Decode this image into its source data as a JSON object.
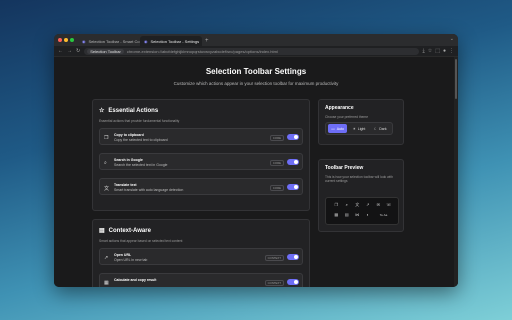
{
  "browser": {
    "tabs": [
      {
        "label": "Selection Toolbar - Smart Co"
      },
      {
        "label": "Selection Toolbar - Settings"
      }
    ],
    "url_chip": "Selection Toolbar",
    "url": "chrome-extension://abcfdefghijklmnopqrstuvwxyzabcdef/src/pages/options/index.html"
  },
  "page": {
    "title": "Selection Toolbar Settings",
    "subtitle": "Customize which actions appear in your selection toolbar for maximum productivity"
  },
  "essential": {
    "title": "Essential Actions",
    "desc": "Essential actions that provide fundamental functionality",
    "items": [
      {
        "title": "Copy to clipboard",
        "desc": "Copy the selected text to clipboard",
        "badge": "CORE",
        "icon": "copy-icon"
      },
      {
        "title": "Search in Google",
        "desc": "Search the selected text in Google",
        "badge": "CORE",
        "icon": "search-icon"
      },
      {
        "title": "Translate text",
        "desc": "Smart translate with auto language detection",
        "badge": "CORE",
        "icon": "translate-icon"
      }
    ]
  },
  "context": {
    "title": "Context-Aware",
    "desc": "Smart actions that appear based on selected text content",
    "items": [
      {
        "title": "Open URL",
        "desc": "Open URL in new tab",
        "badge": "CONTEXT",
        "icon": "external-link-icon"
      },
      {
        "title": "Calculate and copy result",
        "desc": "",
        "badge": "CONTEXT",
        "icon": "calculator-icon"
      }
    ]
  },
  "appearance": {
    "title": "Appearance",
    "desc": "Choose your preferred theme",
    "options": [
      {
        "label": "Auto",
        "selected": true
      },
      {
        "label": "Light",
        "selected": false
      },
      {
        "label": "Dark",
        "selected": false
      }
    ]
  },
  "preview": {
    "title": "Toolbar Preview",
    "desc": "This is how your selection toolbar will look with current settings",
    "more_label": "Te Aa",
    "icons": [
      "copy-icon",
      "search-icon",
      "translate-icon",
      "external-link-icon",
      "email-icon",
      "phone-icon",
      "calendar-icon",
      "calculator-icon",
      "share-icon",
      "color-icon"
    ]
  },
  "colors": {
    "accent": "#6e6ef6",
    "bg": "#1a1a1b",
    "card": "#222224"
  }
}
